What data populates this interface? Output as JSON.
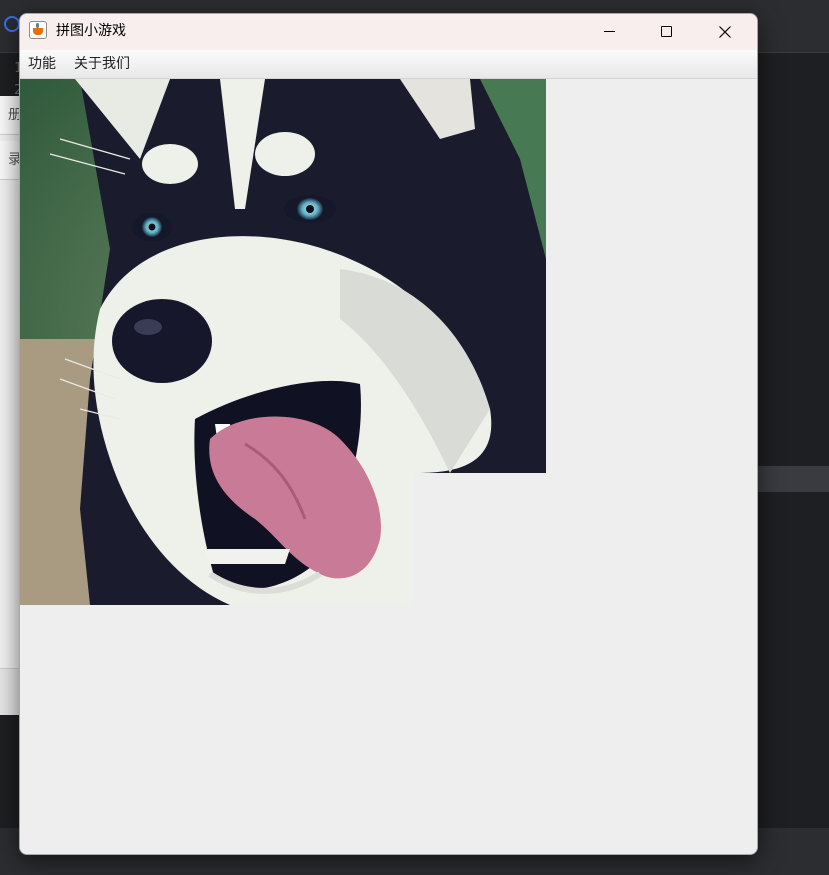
{
  "background_ide": {
    "line_numbers": [
      "1",
      "2"
    ],
    "panel_labels": [
      "册",
      "录"
    ]
  },
  "window": {
    "title": "拼图小游戏",
    "icon": "java-coffee-icon",
    "controls": {
      "minimize_icon": "minimize-icon",
      "maximize_icon": "maximize-icon",
      "close_icon": "close-icon"
    },
    "menu": [
      {
        "label": "功能"
      },
      {
        "label": "关于我们"
      }
    ]
  },
  "puzzle": {
    "image_subject": "husky dog face",
    "empty_tile": "bottom-right",
    "colors": {
      "board_background": "#eeeeee",
      "fur_dark": "#1a1c2e",
      "fur_light": "#eef0ea",
      "tongue": "#c97a96",
      "background_green": "#3d6a48"
    }
  }
}
